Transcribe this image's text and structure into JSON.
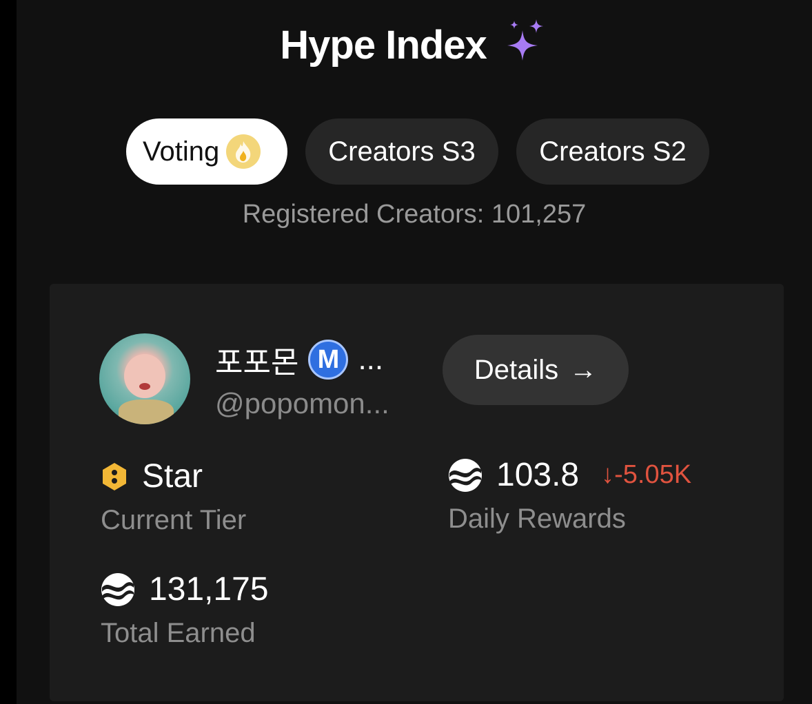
{
  "header": {
    "title": "Hype Index",
    "sparkle_icon": "sparkles-icon"
  },
  "tabs": [
    {
      "label": "Voting",
      "active": true,
      "icon": "fire-icon"
    },
    {
      "label": "Creators S3",
      "active": false
    },
    {
      "label": "Creators S2",
      "active": false
    }
  ],
  "registered_creators": "Registered Creators: 101,257",
  "creator": {
    "name": "포포몬",
    "badge": "M",
    "ellipsis": "...",
    "handle": "@popomon...",
    "details_label": "Details",
    "details_arrow": "→",
    "stats": {
      "tier": {
        "value": "Star",
        "label": "Current Tier"
      },
      "daily": {
        "value": "103.8",
        "change": "↓-5.05K",
        "label": "Daily Rewards"
      },
      "total": {
        "value": "131,175",
        "label": "Total Earned"
      }
    }
  },
  "colors": {
    "background": "#111111",
    "card": "#1c1c1c",
    "accent_purple": "#a77bf3",
    "negative_change": "#e0533f",
    "tier_gold": "#f2b736",
    "verified_blue": "#2f6fe0"
  }
}
